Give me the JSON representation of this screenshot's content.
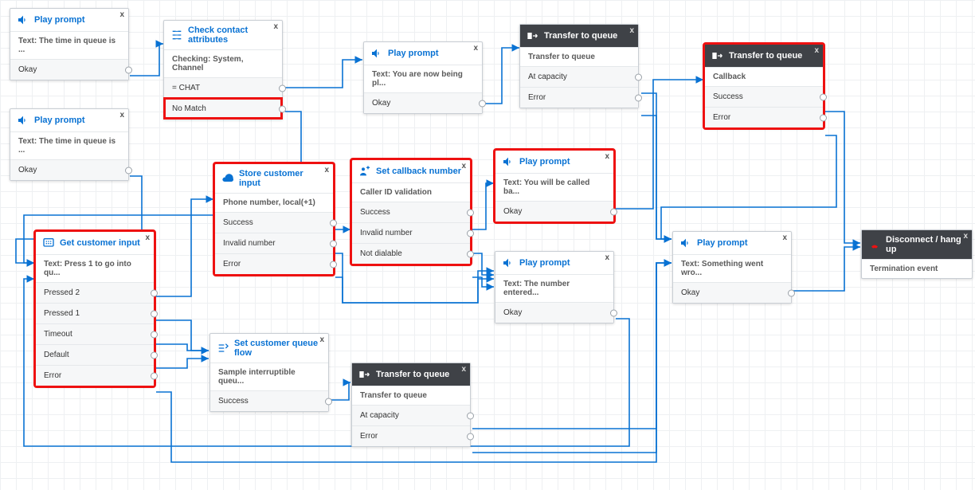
{
  "nodes": {
    "play1": {
      "title": "Play prompt",
      "subtitle": "Text: The time in queue is ...",
      "rows": [
        "Okay"
      ]
    },
    "play2": {
      "title": "Play prompt",
      "subtitle": "Text: The time in queue is ...",
      "rows": [
        "Okay"
      ]
    },
    "check": {
      "title": "Check contact attributes",
      "subtitle": "Checking: System, Channel",
      "rows": [
        "= CHAT",
        "No Match"
      ]
    },
    "play3": {
      "title": "Play prompt",
      "subtitle": "Text: You are now being pl...",
      "rows": [
        "Okay"
      ]
    },
    "xfer1": {
      "title": "Transfer to queue",
      "subtitle": "Transfer to queue",
      "rows": [
        "At capacity",
        "Error"
      ]
    },
    "xfer2": {
      "title": "Transfer to queue",
      "subtitle": "Callback",
      "rows": [
        "Success",
        "Error"
      ]
    },
    "getinput": {
      "title": "Get customer input",
      "subtitle": "Text: Press 1 to go into qu...",
      "rows": [
        "Pressed 2",
        "Pressed 1",
        "Timeout",
        "Default",
        "Error"
      ]
    },
    "store": {
      "title": "Store customer input",
      "subtitle": "Phone number, local(+1)",
      "rows": [
        "Success",
        "Invalid number",
        "Error"
      ]
    },
    "setcb": {
      "title": "Set callback number",
      "subtitle": "Caller ID validation",
      "rows": [
        "Success",
        "Invalid number",
        "Not dialable"
      ]
    },
    "play4": {
      "title": "Play prompt",
      "subtitle": "Text: You will be called ba...",
      "rows": [
        "Okay"
      ]
    },
    "play5": {
      "title": "Play prompt",
      "subtitle": "Text: The number entered...",
      "rows": [
        "Okay"
      ]
    },
    "play6": {
      "title": "Play prompt",
      "subtitle": "Text: Something went wro...",
      "rows": [
        "Okay"
      ]
    },
    "setq": {
      "title": "Set customer queue flow",
      "subtitle": "Sample interruptible queu...",
      "rows": [
        "Success"
      ]
    },
    "xfer3": {
      "title": "Transfer to queue",
      "subtitle": "Transfer to queue",
      "rows": [
        "At capacity",
        "Error"
      ]
    },
    "disc": {
      "title": "Disconnect / hang up",
      "subtitle": "Termination event",
      "rows": []
    }
  },
  "icons": {
    "speaker": "play-prompt-icon",
    "branch": "check-attributes-icon",
    "cloud": "store-input-icon",
    "person": "set-callback-icon",
    "queue": "transfer-queue-icon",
    "input": "get-input-icon",
    "flow": "set-queue-flow-icon",
    "hangup": "disconnect-icon"
  }
}
